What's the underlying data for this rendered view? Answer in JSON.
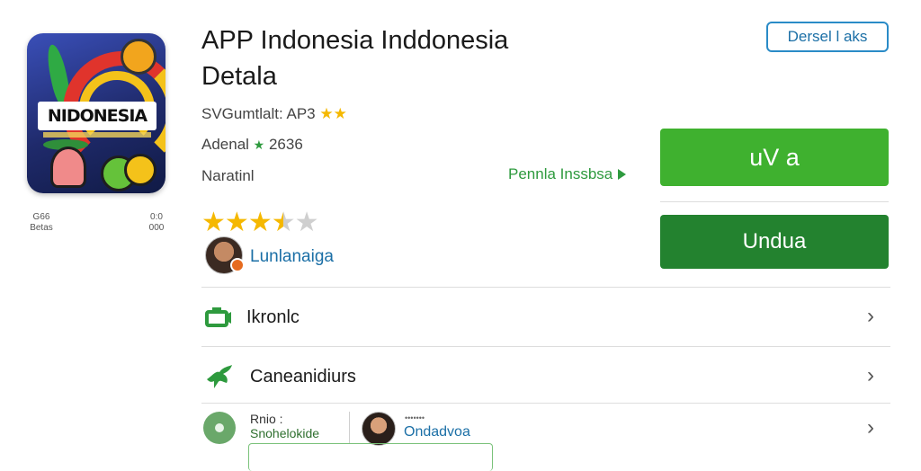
{
  "app": {
    "icon_banner_text": "NIDONESIA",
    "icon_meta_left_1": "G66",
    "icon_meta_left_2": "Betas",
    "icon_meta_right_1": "0:0",
    "icon_meta_right_2": "000",
    "title_line1": "APP Indonesia  Inddonesia",
    "title_line2": "Detala",
    "subtitle_label": "SVGumtlalt: AP3",
    "stats_prefix": "Adenal",
    "stats_value": "2636",
    "category": "Naratinl",
    "rating_value": 3.5,
    "rating_stars_total": 5
  },
  "detail_button": {
    "label": "Dersel l aks"
  },
  "install_link": {
    "label": "Pennla Inssbsa"
  },
  "primary_button": {
    "label": "uV a"
  },
  "secondary_button": {
    "label": "Undua"
  },
  "developer": {
    "name": "Lunlanaiga"
  },
  "rows": [
    {
      "label": "Ikronlc",
      "icon": "camera-icon"
    },
    {
      "label": "Caneanidiurs",
      "icon": "bird-icon"
    }
  ],
  "bottom_row": {
    "mini_label_1": "Rnio :",
    "mini_label_2": "Snohelokide",
    "user_tiny_text": "•••••••",
    "user_name": "Ondadvoa"
  },
  "colors": {
    "primary_green": "#3fb12f",
    "dark_green": "#23822f",
    "link_blue": "#1b6fa6",
    "star_gold": "#f5b800"
  }
}
